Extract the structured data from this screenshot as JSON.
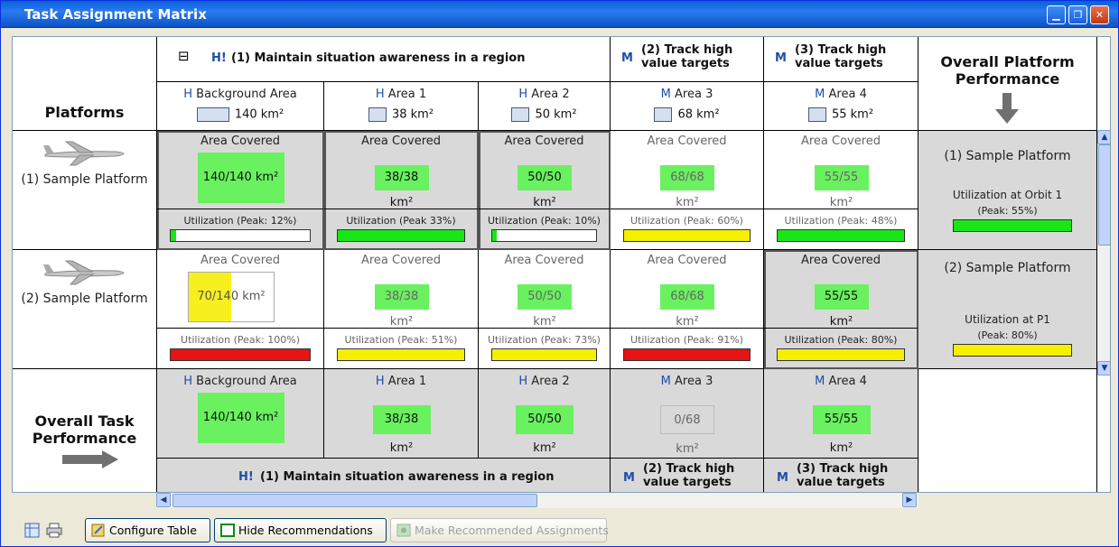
{
  "window": {
    "title": "Task Assignment Matrix"
  },
  "header": {
    "platforms_label": "Platforms",
    "task1": {
      "priority": "H!",
      "label": "(1) Maintain situation awareness in a region",
      "collapse": "⊟"
    },
    "task2": {
      "priority": "M",
      "label": "(2) Track high value targets"
    },
    "task3": {
      "priority": "M",
      "label": "(3) Track high value targets"
    },
    "overall_platform_label": "Overall Platform Performance",
    "areas": [
      {
        "priority": "H",
        "name": "Background Area",
        "size": "140 km²"
      },
      {
        "priority": "H",
        "name": "Area 1",
        "size": "38 km²"
      },
      {
        "priority": "H",
        "name": "Area 2",
        "size": "50 km²"
      },
      {
        "priority": "M",
        "name": "Area 3",
        "size": "68 km²"
      },
      {
        "priority": "M",
        "name": "Area 4",
        "size": "55 km²"
      }
    ]
  },
  "area_covered_label": "Area Covered",
  "platforms": [
    {
      "name": "(1) Sample Platform",
      "cells": [
        {
          "value": "140/140 km²",
          "util": "Utilization (Peak: 12%)",
          "util_fraction": 0.12,
          "util_color": "#19e619"
        },
        {
          "value": "38/38 km²",
          "util": "Utilization (Peak 33%)",
          "util_fraction": 1,
          "util_color": "#19e619"
        },
        {
          "value": "50/50 km²",
          "util": "Utilization (Peak: 10%)",
          "util_fraction": 0.1,
          "util_color": "#19e619"
        },
        {
          "value": "68/68 km²",
          "util": "Utilization (Peak: 60%)",
          "util_fraction": 1,
          "util_color": "#f5f000"
        },
        {
          "value": "55/55 km²",
          "util": "Utilization (Peak: 48%)",
          "util_fraction": 1,
          "util_color": "#19e619"
        }
      ],
      "overall": {
        "title": "(1) Sample Platform",
        "util_label": "Utilization at Orbit 1",
        "peak": "(Peak: 55%)",
        "fill_fraction": 1,
        "color": "#19e619"
      }
    },
    {
      "name": "(2) Sample Platform",
      "cells": [
        {
          "value_covered": "70/",
          "value_total": "140 km²",
          "util": "Utilization (Peak: 100%)",
          "util_fraction": 1,
          "util_color": "#e61414"
        },
        {
          "value": "38/38 km²",
          "util": "Utilization (Peak: 51%)",
          "util_fraction": 1,
          "util_color": "#f5f000"
        },
        {
          "value": "50/50 km²",
          "util": "Utilization (Peak: 73%)",
          "util_fraction": 1,
          "util_color": "#f5f000"
        },
        {
          "value": "68/68 km²",
          "util": "Utilization (Peak: 91%)",
          "util_fraction": 1,
          "util_color": "#e61414"
        },
        {
          "value": "55/55 km²",
          "util": "Utilization (Peak: 80%)",
          "util_fraction": 1,
          "util_color": "#f5f000"
        }
      ],
      "overall": {
        "title": "(2) Sample Platform",
        "util_label": "Utilization at P1",
        "peak": "(Peak: 80%)",
        "fill_fraction": 1,
        "color": "#f5f000"
      }
    }
  ],
  "overall_task": {
    "label": "Overall Task Performance",
    "areas": [
      {
        "priority": "H",
        "name": "Background Area",
        "value": "140/140 km²"
      },
      {
        "priority": "H",
        "name": "Area 1",
        "value": "38/38 km²"
      },
      {
        "priority": "H",
        "name": "Area 2",
        "value": "50/50 km²"
      },
      {
        "priority": "M",
        "name": "Area 3",
        "value": "0/68 km²"
      },
      {
        "priority": "M",
        "name": "Area 4",
        "value": "55/55 km²"
      }
    ],
    "task1": {
      "priority": "H!",
      "label": "(1) Maintain situation awareness in a region"
    },
    "task2": {
      "priority": "M",
      "label": "(2) Track high value targets"
    },
    "task3": {
      "priority": "M",
      "label": "(3) Track high value targets"
    }
  },
  "toolbar": {
    "configure": "Configure Table",
    "hide": "Hide Recommendations",
    "make": "Make Recommended Assignments"
  }
}
